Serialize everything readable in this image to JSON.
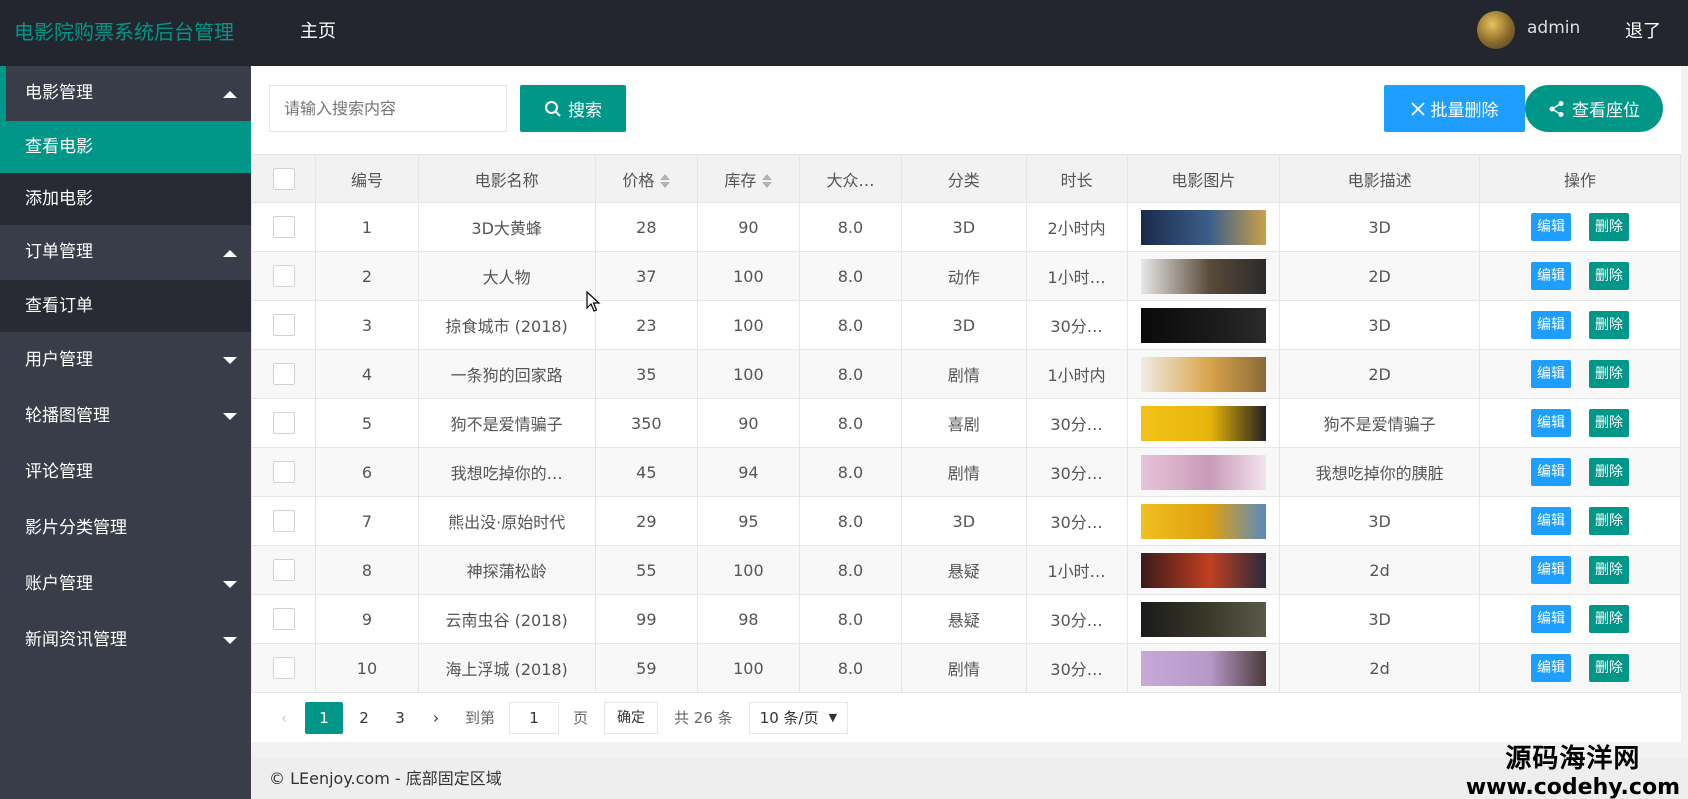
{
  "app": {
    "title": "电影院购票系统后台管理",
    "nav_home": "主页",
    "user": "admin",
    "logout": "退了"
  },
  "sidebar": {
    "groups": [
      {
        "label": "电影管理",
        "state": "open",
        "items": [
          {
            "label": "查看电影",
            "active": true
          },
          {
            "label": "添加电影",
            "active": false
          }
        ]
      },
      {
        "label": "订单管理",
        "state": "open",
        "items": [
          {
            "label": "查看订单",
            "active": false
          }
        ]
      }
    ],
    "items": [
      {
        "label": "用户管理",
        "has_caret": true
      },
      {
        "label": "轮播图管理",
        "has_caret": true
      },
      {
        "label": "评论管理",
        "has_caret": false
      },
      {
        "label": "影片分类管理",
        "has_caret": false
      },
      {
        "label": "账户管理",
        "has_caret": true
      },
      {
        "label": "新闻资讯管理",
        "has_caret": true
      }
    ]
  },
  "toolbar": {
    "search_placeholder": "请输入搜索内容",
    "search_label": "搜索",
    "batch_delete_label": "批量删除",
    "view_seats_label": "查看座位"
  },
  "table": {
    "headers": [
      "编号",
      "电影名称",
      "价格",
      "库存",
      "大众…",
      "分类",
      "时长",
      "电影图片",
      "电影描述",
      "操作"
    ],
    "edit_label": "编辑",
    "delete_label": "删除",
    "rows": [
      {
        "id": "1",
        "name": "3D大黄蜂",
        "price": "28",
        "stock": "90",
        "rating": "8.0",
        "category": "3D",
        "duration": "2小时内",
        "desc": "3D",
        "thumb": [
          "#1a2a4a",
          "#3b5f8a",
          "#c9a24a"
        ]
      },
      {
        "id": "2",
        "name": "大人物",
        "price": "37",
        "stock": "100",
        "rating": "8.0",
        "category": "动作",
        "duration": "1小时…",
        "desc": "2D",
        "thumb": [
          "#e8e8e8",
          "#5a4a3a",
          "#2a2a2a"
        ]
      },
      {
        "id": "3",
        "name": "掠食城市 (2018)",
        "price": "23",
        "stock": "100",
        "rating": "8.0",
        "category": "3D",
        "duration": "30分…",
        "desc": "3D",
        "thumb": [
          "#0a0a0a",
          "#1a1a1a",
          "#2a2a2a"
        ]
      },
      {
        "id": "4",
        "name": "一条狗的回家路",
        "price": "35",
        "stock": "100",
        "rating": "8.0",
        "category": "剧情",
        "duration": "1小时内",
        "desc": "2D",
        "thumb": [
          "#f0ece4",
          "#d9a44a",
          "#8a6a3a"
        ]
      },
      {
        "id": "5",
        "name": "狗不是爱情骗子",
        "price": "350",
        "stock": "90",
        "rating": "8.0",
        "category": "喜剧",
        "duration": "30分…",
        "desc": "狗不是爱情骗子",
        "thumb": [
          "#f2c21a",
          "#e8b40a",
          "#222222"
        ]
      },
      {
        "id": "6",
        "name": "我想吃掉你的…",
        "price": "45",
        "stock": "94",
        "rating": "8.0",
        "category": "剧情",
        "duration": "30分…",
        "desc": "我想吃掉你的胰脏",
        "thumb": [
          "#e8c4d8",
          "#c89ab8",
          "#f4e4ec"
        ]
      },
      {
        "id": "7",
        "name": "熊出没·原始时代",
        "price": "29",
        "stock": "95",
        "rating": "8.0",
        "category": "3D",
        "duration": "30分…",
        "desc": "3D",
        "thumb": [
          "#f0c020",
          "#e0a010",
          "#5a8ac0"
        ]
      },
      {
        "id": "8",
        "name": "神探蒲松龄",
        "price": "55",
        "stock": "100",
        "rating": "8.0",
        "category": "悬疑",
        "duration": "1小时…",
        "desc": "2d",
        "thumb": [
          "#3a1a1a",
          "#c04020",
          "#2a2a3a"
        ]
      },
      {
        "id": "9",
        "name": "云南虫谷 (2018)",
        "price": "99",
        "stock": "98",
        "rating": "8.0",
        "category": "悬疑",
        "duration": "30分…",
        "desc": "3D",
        "thumb": [
          "#1a1a1a",
          "#3a3a2a",
          "#5a5a4a"
        ]
      },
      {
        "id": "10",
        "name": "海上浮城 (2018)",
        "price": "59",
        "stock": "100",
        "rating": "8.0",
        "category": "剧情",
        "duration": "30分…",
        "desc": "2d",
        "thumb": [
          "#c8a8d8",
          "#b898c8",
          "#4a3a3a"
        ]
      }
    ]
  },
  "pager": {
    "pages": [
      "1",
      "2",
      "3"
    ],
    "current": "1",
    "goto_label": "到第",
    "goto_value": "1",
    "page_unit": "页",
    "confirm_label": "确定",
    "total_label": "共 26 条",
    "per_page_label": "10 条/页"
  },
  "footer": {
    "text": "© LEenjoy.com - 底部固定区域"
  },
  "watermark": {
    "line1": "源码海洋网",
    "line2": "www.codehy.com"
  },
  "colors": {
    "primary": "#009688",
    "blue": "#1e9fff",
    "dark": "#23262e",
    "sidebar": "#393d49"
  }
}
